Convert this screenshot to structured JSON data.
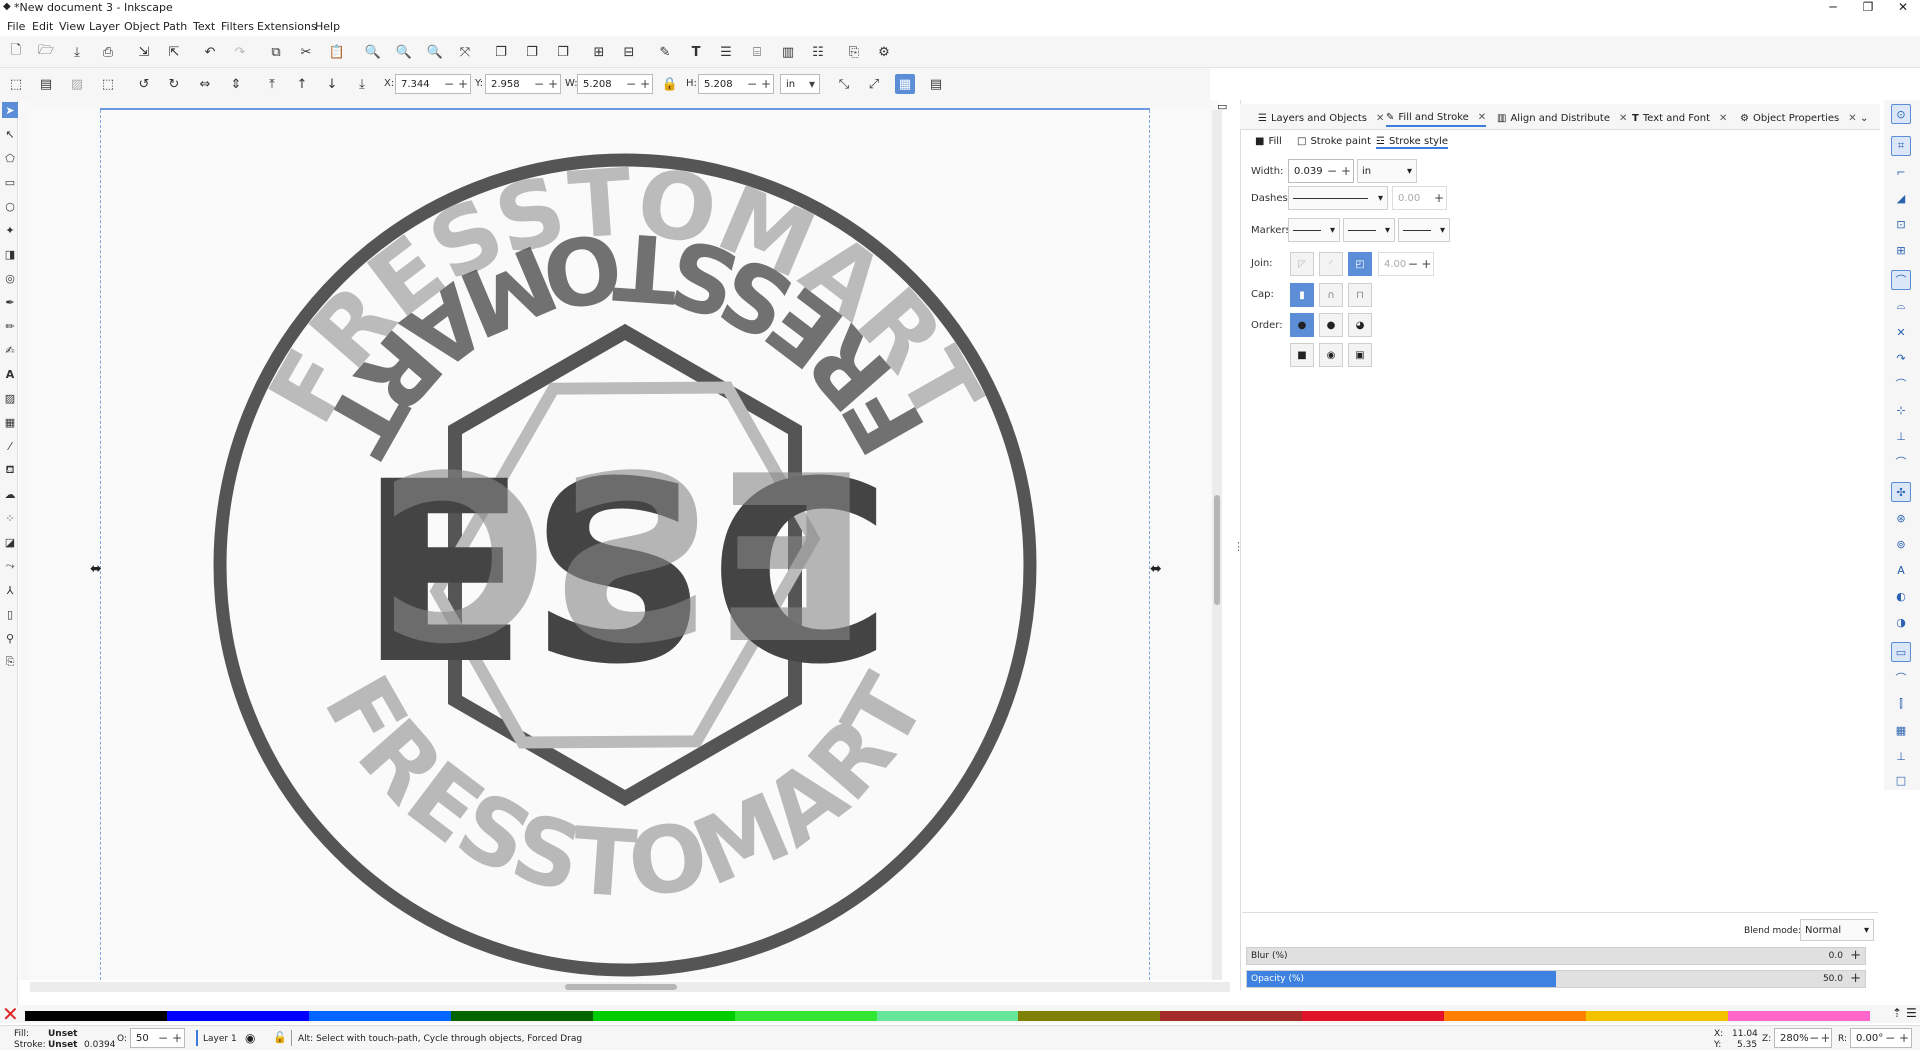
{
  "window": {
    "title": "*New document 3 - Inkscape",
    "minimize": "─",
    "maximize": "❐",
    "close": "✕"
  },
  "menu": [
    "File",
    "Edit",
    "View",
    "Layer",
    "Object",
    "Path",
    "Text",
    "Filters",
    "Extensions",
    "Help"
  ],
  "toolbar": {
    "x_label": "X:",
    "x_value": "7.344",
    "y_label": "Y:",
    "y_value": "2.958",
    "w_label": "W:",
    "w_value": "5.208",
    "h_label": "H:",
    "h_value": "5.208",
    "unit": "in"
  },
  "artwork": {
    "top_text": "FRESSTOMART",
    "bottom_text": "FRESSTOMART",
    "center_text": "ESC"
  },
  "dock": {
    "tabs": [
      {
        "label": "Layers and Objects",
        "icon": "layers-icon"
      },
      {
        "label": "Fill and Stroke",
        "icon": "fill-stroke-icon"
      },
      {
        "label": "Align and Distribute",
        "icon": "align-icon"
      },
      {
        "label": "Text and Font",
        "icon": "text-icon"
      },
      {
        "label": "Object Properties",
        "icon": "properties-icon"
      }
    ],
    "active_tab": "Fill and Stroke",
    "subtabs": [
      "Fill",
      "Stroke paint",
      "Stroke style"
    ],
    "active_subtab": "Stroke style",
    "stroke_style": {
      "width_label": "Width:",
      "width_value": "0.039",
      "width_unit": "in",
      "dashes_label": "Dashes:",
      "dashes_offset": "0.00",
      "markers_label": "Markers:",
      "join_label": "Join:",
      "miter_value": "4.00",
      "cap_label": "Cap:",
      "order_label": "Order:"
    },
    "blend_label": "Blend mode:",
    "blend_value": "Normal",
    "blur_label": "Blur (%)",
    "blur_value": "0.0",
    "blur_fraction": 0.0,
    "opacity_label": "Opacity (%)",
    "opacity_value": "50.0",
    "opacity_fraction": 0.5
  },
  "palette": [
    "#000000",
    "#0000ff",
    "#0066ff",
    "#006400",
    "#00cc00",
    "#33e633",
    "#66e699",
    "#808000",
    "#a52a2a",
    "#e3122b",
    "#ff7f00",
    "#f3c200",
    "#ff66cc"
  ],
  "status": {
    "fill_label": "Fill:",
    "fill_value": "Unset",
    "stroke_label": "Stroke:",
    "stroke_value": "Unset",
    "stroke_width": "0.0394",
    "opacity_label": "O:",
    "opacity_value": "50",
    "layer": "Layer 1",
    "message": "Alt: Select with touch-path, Cycle through objects, Forced Drag",
    "x_label": "X:",
    "x_value": "11.04",
    "y_label": "Y:",
    "y_value": "5.35",
    "zoom_label": "Z:",
    "zoom_value": "280%",
    "rotate_label": "R:",
    "rotate_value": "0.00°"
  }
}
